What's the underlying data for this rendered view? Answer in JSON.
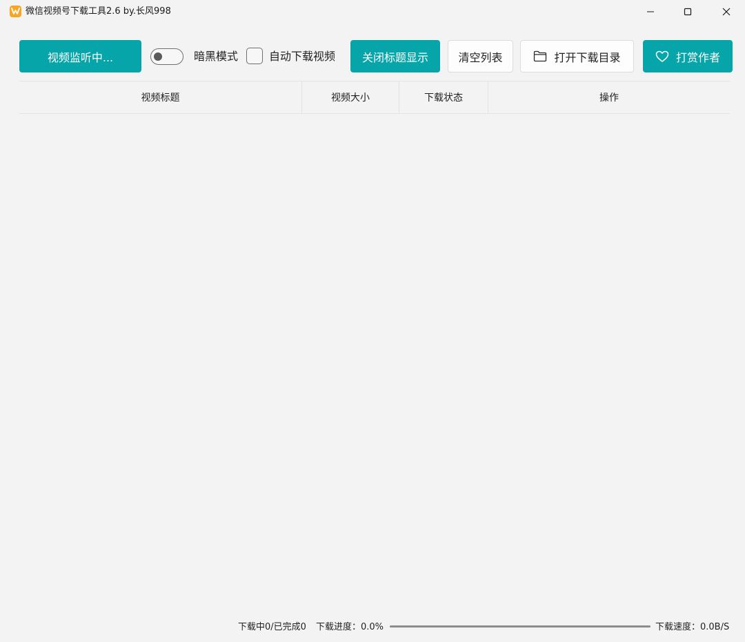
{
  "window": {
    "title": "微信视频号下载工具2.6 by.长风998"
  },
  "toolbar": {
    "monitor_button": "视频监听中...",
    "dark_mode_label": "暗黑模式",
    "dark_mode_on": false,
    "auto_download_label": "自动下载视频",
    "auto_download_checked": false,
    "hide_title_button": "关闭标题显示",
    "clear_list_button": "清空列表",
    "open_dir_button": "打开下载目录",
    "donate_button": "打赏作者"
  },
  "table": {
    "columns": [
      "视频标题",
      "视频大小",
      "下载状态",
      "操作"
    ],
    "rows": []
  },
  "status": {
    "counts": "下载中0/已完成0",
    "progress_label": "下载进度：0.0%",
    "progress_percent": 0,
    "speed_label": "下载速度：0.0B/S"
  },
  "colors": {
    "accent": "#05a5a9",
    "background": "#f3f3f3",
    "logo": "#f6a623"
  },
  "icons": {
    "logo": "app-logo-icon",
    "minimize": "minimize-icon",
    "maximize": "maximize-icon",
    "close": "close-icon",
    "folder": "folder-icon",
    "heart": "heart-icon"
  }
}
